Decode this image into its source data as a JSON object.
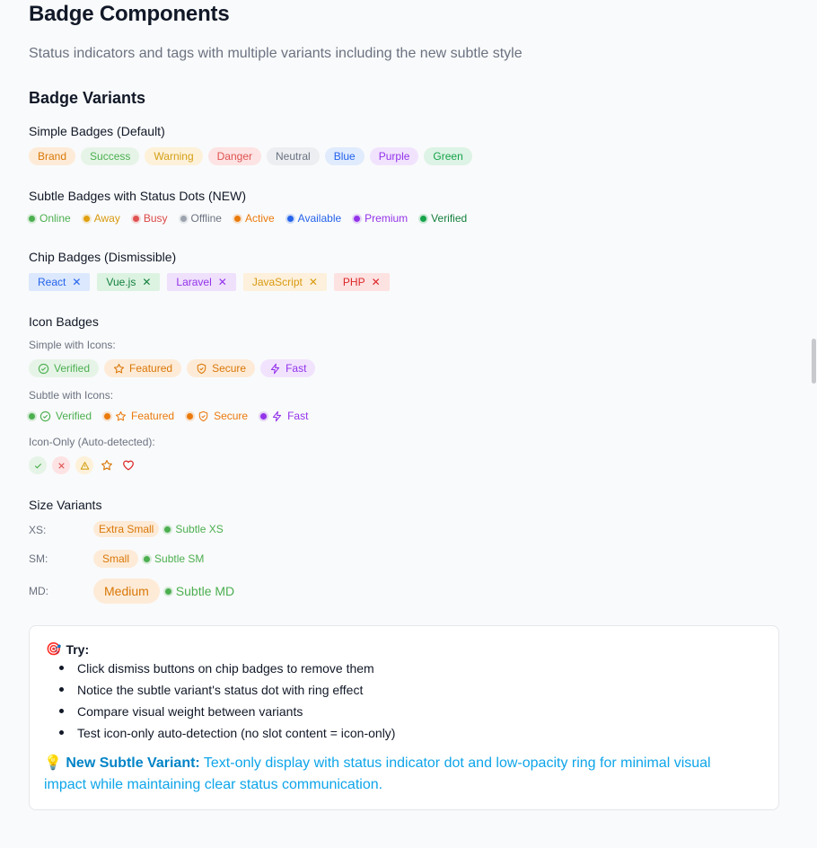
{
  "header": {
    "title": "Badge Components",
    "subtitle": "Status indicators and tags with multiple variants including the new subtle style"
  },
  "section_title": "Badge Variants",
  "simple": {
    "title": "Simple Badges (Default)",
    "items": [
      "Brand",
      "Success",
      "Warning",
      "Danger",
      "Neutral",
      "Blue",
      "Purple",
      "Green"
    ]
  },
  "subtle": {
    "title": "Subtle Badges with Status Dots (NEW)",
    "items": [
      "Online",
      "Away",
      "Busy",
      "Offline",
      "Active",
      "Available",
      "Premium",
      "Verified"
    ]
  },
  "chips": {
    "title": "Chip Badges (Dismissible)",
    "items": [
      "React",
      "Vue.js",
      "Laravel",
      "JavaScript",
      "PHP"
    ],
    "dismiss_glyph": "✕"
  },
  "icon_badges": {
    "title": "Icon Badges",
    "simple_label": "Simple with Icons:",
    "simple_items": [
      "Verified",
      "Featured",
      "Secure",
      "Fast"
    ],
    "subtle_label": "Subtle with Icons:",
    "subtle_items": [
      "Verified",
      "Featured",
      "Secure",
      "Fast"
    ],
    "icon_only_label": "Icon-Only (Auto-detected):",
    "icon_names": [
      "check-circle-icon",
      "star-icon",
      "shield-icon",
      "bolt-icon",
      "check-icon",
      "x-icon",
      "warning-icon",
      "heart-icon"
    ]
  },
  "sizes": {
    "title": "Size Variants",
    "rows": [
      {
        "label": "XS:",
        "badge": "Extra Small",
        "subtle": "Subtle XS"
      },
      {
        "label": "SM:",
        "badge": "Small",
        "subtle": "Subtle SM"
      },
      {
        "label": "MD:",
        "badge": "Medium",
        "subtle": "Subtle MD"
      }
    ]
  },
  "try": {
    "emoji": "🎯",
    "heading": "Try:",
    "items": [
      "Click dismiss buttons on chip badges to remove them",
      "Notice the subtle variant's status dot with ring effect",
      "Compare visual weight between variants",
      "Test icon-only auto-detection (no slot content = icon-only)"
    ],
    "note_emoji": "💡",
    "note_label": "New Subtle Variant:",
    "note_text": "Text-only display with status indicator dot and low-opacity ring for minimal visual impact while maintaining clear status communication."
  },
  "colors": {
    "brand": "#d97706",
    "success": "#4caf50",
    "warning": "#d4a017",
    "danger": "#e05252",
    "neutral": "#6b7280",
    "blue": "#2563eb",
    "purple": "#9333ea",
    "green": "#16a34a",
    "note": "#0ea5e9"
  }
}
